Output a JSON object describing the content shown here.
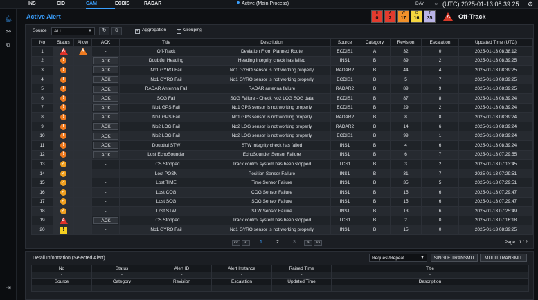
{
  "topbar": {
    "tabs": [
      {
        "label": "INS",
        "active": false
      },
      {
        "label": "CID",
        "active": false
      },
      {
        "label": "CAM",
        "active": true
      },
      {
        "label": "ECDIS",
        "active": false
      },
      {
        "label": "RADAR",
        "active": false
      }
    ],
    "process_status": "Active (Main Process)",
    "mode": "DAY",
    "clock": "(UTC) 2025-01-13 08:39:25"
  },
  "sidebar_icons": [
    "bell-icon",
    "network-icon",
    "copy-icon",
    "logout-icon"
  ],
  "page_title": "Active Alert",
  "alert_counts": [
    {
      "letter": "E",
      "count": "0",
      "color": "#e23b2e"
    },
    {
      "letter": "A",
      "count": "2",
      "color": "#e23b2e"
    },
    {
      "letter": "W",
      "count": "17",
      "color": "#f0902a"
    },
    {
      "letter": "C",
      "count": "16",
      "color": "#f5d640"
    },
    {
      "letter": "T",
      "count": "35",
      "color": "#b9b3e6"
    }
  ],
  "top_alert": {
    "label": "Off-Track",
    "symbol": "A"
  },
  "toolbar": {
    "source_label": "Source",
    "source_value": "ALL",
    "aggregation_label": "Aggregation",
    "grouping_label": "Grouping"
  },
  "columns": [
    "No",
    "Status",
    "Allow",
    "ACK",
    "Title",
    "Description",
    "Source",
    "Category",
    "Revision",
    "Escalation",
    "Updated Time (UTC)"
  ],
  "rows": [
    {
      "no": "1",
      "status": "alarm-red",
      "allow": "alarm-orange",
      "ack": "-",
      "ack_button": false,
      "title": "Off-Track",
      "desc": "Deviation From Planned Route",
      "source": "ECDIS1",
      "cat": "A",
      "rev": "32",
      "esc": "0",
      "time": "2025-01-13 08:38:12"
    },
    {
      "no": "2",
      "status": "warn",
      "allow": "",
      "ack": "ACK",
      "ack_button": true,
      "title": "Doubtful Heading",
      "desc": "Heading integrity check has failed",
      "source": "INS1",
      "cat": "B",
      "rev": "89",
      "esc": "2",
      "time": "2025-01-13 08:39:25"
    },
    {
      "no": "3",
      "status": "warn",
      "allow": "",
      "ack": "ACK",
      "ack_button": true,
      "title": "No1 GYRO Fail",
      "desc": "No1 GYRO sensor is not working properly",
      "source": "RADAR2",
      "cat": "B",
      "rev": "44",
      "esc": "4",
      "time": "2025-01-13 08:39:25"
    },
    {
      "no": "4",
      "status": "warn",
      "allow": "",
      "ack": "ACK",
      "ack_button": true,
      "title": "No1 GYRO Fail",
      "desc": "No1 GYRO sensor is not working properly",
      "source": "ECDIS1",
      "cat": "B",
      "rev": "5",
      "esc": "7",
      "time": "2025-01-13 08:39:25"
    },
    {
      "no": "5",
      "status": "warn",
      "allow": "",
      "ack": "ACK",
      "ack_button": true,
      "title": "RADAR Antenna Fail",
      "desc": "RADAR antenna failure",
      "source": "RADAR2",
      "cat": "B",
      "rev": "89",
      "esc": "9",
      "time": "2025-01-13 08:39:25"
    },
    {
      "no": "6",
      "status": "warn",
      "allow": "",
      "ack": "ACK",
      "ack_button": true,
      "title": "SOG Fail",
      "desc": "SOG Failure - Check No2 LOG SOG data",
      "source": "ECDIS1",
      "cat": "B",
      "rev": "87",
      "esc": "8",
      "time": "2025-01-13 08:39:24"
    },
    {
      "no": "7",
      "status": "warn",
      "allow": "",
      "ack": "ACK",
      "ack_button": true,
      "title": "No1 GPS Fail",
      "desc": "No1 GPS sensor is not working properly",
      "source": "ECDIS1",
      "cat": "B",
      "rev": "29",
      "esc": "2",
      "time": "2025-01-13 08:39:24"
    },
    {
      "no": "8",
      "status": "warn",
      "allow": "",
      "ack": "ACK",
      "ack_button": true,
      "title": "No1 GPS Fail",
      "desc": "No1 GPS sensor is not working properly",
      "source": "RADAR2",
      "cat": "B",
      "rev": "8",
      "esc": "8",
      "time": "2025-01-13 08:39:24"
    },
    {
      "no": "9",
      "status": "warn",
      "allow": "",
      "ack": "ACK",
      "ack_button": true,
      "title": "No2 LOG Fail",
      "desc": "No2 LOG sensor is not working properly",
      "source": "RADAR2",
      "cat": "B",
      "rev": "14",
      "esc": "6",
      "time": "2025-01-13 08:39:24"
    },
    {
      "no": "10",
      "status": "warn",
      "allow": "",
      "ack": "ACK",
      "ack_button": true,
      "title": "No2 LOG Fail",
      "desc": "No2 LOG sensor is not working properly",
      "source": "ECDIS1",
      "cat": "B",
      "rev": "99",
      "esc": "1",
      "time": "2025-01-13 08:39:24"
    },
    {
      "no": "11",
      "status": "warn",
      "allow": "",
      "ack": "ACK",
      "ack_button": true,
      "title": "Doubtful STW",
      "desc": "STW integrity check has failed",
      "source": "INS1",
      "cat": "B",
      "rev": "4",
      "esc": "6",
      "time": "2025-01-13 08:39:24"
    },
    {
      "no": "12",
      "status": "warn",
      "allow": "",
      "ack": "ACK",
      "ack_button": true,
      "title": "Lost EchoSounder",
      "desc": "EchoSounder Sensor Failure",
      "source": "INS1",
      "cat": "B",
      "rev": "6",
      "esc": "7",
      "time": "2025-01-13 07:29:55"
    },
    {
      "no": "13",
      "status": "acked",
      "allow": "",
      "ack": "-",
      "ack_button": false,
      "title": "TCS Stopped",
      "desc": "Track control system has been stopped",
      "source": "TCS1",
      "cat": "B",
      "rev": "3",
      "esc": "2",
      "time": "2025-01-13 07:13:45"
    },
    {
      "no": "14",
      "status": "acked",
      "allow": "",
      "ack": "-",
      "ack_button": false,
      "title": "Lost POSN",
      "desc": "Position Sensor Failure",
      "source": "INS1",
      "cat": "B",
      "rev": "31",
      "esc": "7",
      "time": "2025-01-13 07:29:51"
    },
    {
      "no": "15",
      "status": "acked",
      "allow": "",
      "ack": "-",
      "ack_button": false,
      "title": "Lost TIME",
      "desc": "Time Sensor Failure",
      "source": "INS1",
      "cat": "B",
      "rev": "35",
      "esc": "5",
      "time": "2025-01-13 07:29:51"
    },
    {
      "no": "16",
      "status": "acked",
      "allow": "",
      "ack": "-",
      "ack_button": false,
      "title": "Lost COG",
      "desc": "COG Sensor Failure",
      "source": "INS1",
      "cat": "B",
      "rev": "15",
      "esc": "6",
      "time": "2025-01-13 07:29:47"
    },
    {
      "no": "17",
      "status": "acked",
      "allow": "",
      "ack": "-",
      "ack_button": false,
      "title": "Lost SOG",
      "desc": "SOG Sensor Failure",
      "source": "INS1",
      "cat": "B",
      "rev": "15",
      "esc": "6",
      "time": "2025-01-13 07:29:47"
    },
    {
      "no": "18",
      "status": "acked",
      "allow": "",
      "ack": "-",
      "ack_button": false,
      "title": "Lost STW",
      "desc": "STW Sensor Failure",
      "source": "INS1",
      "cat": "B",
      "rev": "13",
      "esc": "6",
      "time": "2025-01-13 07:25:49"
    },
    {
      "no": "19",
      "status": "alarm-red",
      "allow": "",
      "ack": "ACK",
      "ack_button": true,
      "title": "TCS Stopped",
      "desc": "Track control system has been stopped",
      "source": "TCS1",
      "cat": "B",
      "rev": "2",
      "esc": "0",
      "time": "2025-01-13 07:16:18"
    },
    {
      "no": "20",
      "status": "caution",
      "allow": "",
      "ack": "-",
      "ack_button": false,
      "title": "No1 GYRO Fail",
      "desc": "No1 GYRO sensor is not working properly",
      "source": "INS1",
      "cat": "B",
      "rev": "15",
      "esc": "0",
      "time": "2025-01-13 08:39:25"
    }
  ],
  "pagination": {
    "first": "<<",
    "prev": "<",
    "next": ">",
    "last": ">>",
    "pages": [
      "1",
      "2",
      "3"
    ],
    "current": "1",
    "info": "Page : 1 / 2"
  },
  "detail": {
    "title": "Detail Information (Selected Alert)",
    "select_value": "Request/Repeat",
    "single_transmit": "SINGLE TRANSMIT",
    "multi_transmit": "MULTI TRANSMIT",
    "row1_headers": [
      "No",
      "Status",
      "Alert ID",
      "Alert Instance",
      "Raised Time",
      "Title"
    ],
    "row1_values": [
      "-",
      "-",
      "-",
      "-",
      "-",
      "-"
    ],
    "row2_headers": [
      "Source",
      "Category",
      "Revision",
      "Escalation",
      "Updated Time",
      "Description"
    ],
    "row2_values": [
      "-",
      "-",
      "-",
      "-",
      "-",
      "-"
    ]
  }
}
